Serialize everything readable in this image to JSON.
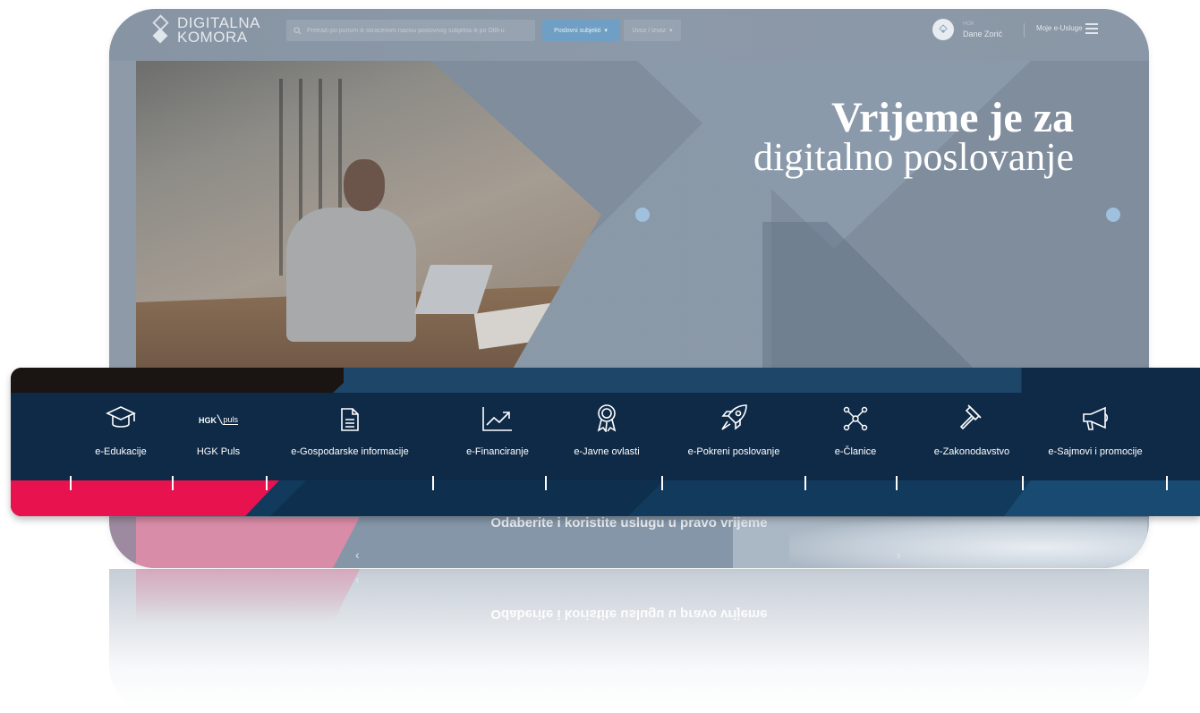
{
  "header": {
    "logo_line1": "DIGITALNA",
    "logo_line2": "KOMORA",
    "search_placeholder": "Pretraži po punom ili skraćenom nazivu poslovnog subjekta ili po OIB-u",
    "search_scope": "Poslovni subjekti",
    "login_label": "Uvoz / izvoz",
    "user_org": "HGK",
    "user_name": "Dane Zorić",
    "my_services": "Moje e-Usluge"
  },
  "hero": {
    "headline_bold": "Vrijeme je za",
    "headline_regular": "digitalno poslovanje"
  },
  "lower": {
    "tagline": "Odaberite i koristite uslugu u pravo vrijeme",
    "prev_arrow": "‹",
    "next_arrow": "›"
  },
  "services": [
    {
      "label": "e-Edukacije",
      "icon": "graduation-cap-icon"
    },
    {
      "label": "HGK Puls",
      "icon": "hgk-puls-logo"
    },
    {
      "label": "e-Gospodarske informacije",
      "icon": "document-icon"
    },
    {
      "label": "e-Financiranje",
      "icon": "trend-chart-icon"
    },
    {
      "label": "e-Javne ovlasti",
      "icon": "award-badge-icon"
    },
    {
      "label": "e-Pokreni poslovanje",
      "icon": "rocket-icon"
    },
    {
      "label": "e-Članice",
      "icon": "network-icon"
    },
    {
      "label": "e-Zakonodavstvo",
      "icon": "gavel-icon"
    },
    {
      "label": "e-Sajmovi i promocije",
      "icon": "megaphone-icon"
    }
  ],
  "hgk_logo": {
    "left": "HGK",
    "right": "puls"
  },
  "colors": {
    "bar_bg": "#0f2a47",
    "accent_pink": "#e8124f",
    "accent_blue": "#6f9fc4"
  }
}
